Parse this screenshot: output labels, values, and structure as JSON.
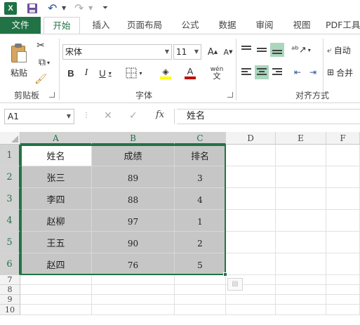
{
  "colors": {
    "accent": "#217346",
    "selection_fill": "#c6c6c6"
  },
  "qat": {
    "logo_letter": "X",
    "icons": [
      "excel-logo",
      "save-icon",
      "undo-icon",
      "redo-icon",
      "customize-icon"
    ]
  },
  "tabs": [
    "文件",
    "开始",
    "插入",
    "页面布局",
    "公式",
    "数据",
    "审阅",
    "视图",
    "PDF工具"
  ],
  "ribbon": {
    "clipboard": {
      "paste_label": "粘贴",
      "group_label": "剪贴板"
    },
    "font": {
      "name": "宋体",
      "size": "11",
      "grow_label": "A",
      "shrink_label": "A",
      "bold": "B",
      "italic": "I",
      "underline": "U",
      "fill_label": "",
      "color_label": "A",
      "phonetic": "wén",
      "group_label": "字体"
    },
    "alignment": {
      "group_label": "对齐方式",
      "wrap_label": "自动",
      "merge_label": "合并"
    }
  },
  "formula_bar": {
    "name_box": "A1",
    "fx_label": "fx",
    "value": "姓名"
  },
  "sheet": {
    "columns": [
      "A",
      "B",
      "C",
      "D",
      "E",
      "F"
    ],
    "rows": [
      "1",
      "2",
      "3",
      "4",
      "5",
      "6",
      "7",
      "8",
      "9",
      "10"
    ],
    "data": [
      [
        "姓名",
        "成绩",
        "排名"
      ],
      [
        "张三",
        "89",
        "3"
      ],
      [
        "李四",
        "88",
        "4"
      ],
      [
        "赵柳",
        "97",
        "1"
      ],
      [
        "王五",
        "90",
        "2"
      ],
      [
        "赵四",
        "76",
        "5"
      ]
    ]
  }
}
